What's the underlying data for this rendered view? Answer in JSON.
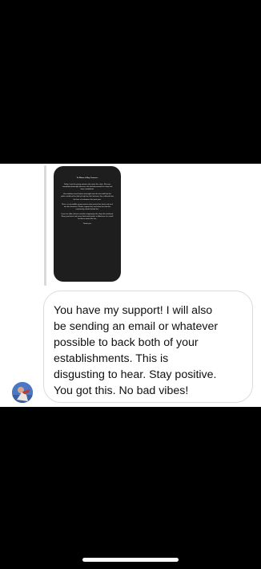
{
  "chat": {
    "story_reply": {
      "title": "To Whom It May Concern:",
      "paragraphs": [
        "Today I met the young woman who owns this store. She was completely distraught because she had discovered her shop had been vandalized.",
        "Her windows were broken overnight and she was told that the police would not be able to help her. Her business has suffered from the loss of customers this past year.",
        "She is an incredible young woman who poured her heart and soul into this business. Please support her and show her that this community stands behind her.",
        "If you are able, please consider stopping by the shop this weekend. Every purchase and every kind word makes a difference to a small business owner like her.",
        "Thank you."
      ]
    },
    "message_text": "You have my support! I will also\nbe sending an email or whatever\npossible to back both of your\nestablishments.  This is\ndisgusting to hear.  Stay positive.\nYou got this. No bad vibes!"
  },
  "colors": {
    "background": "#000000",
    "chat_background": "#ffffff",
    "bubble_border": "#dbdbdb",
    "text": "#111111"
  },
  "icons": {
    "avatar": "avatar-icon"
  }
}
